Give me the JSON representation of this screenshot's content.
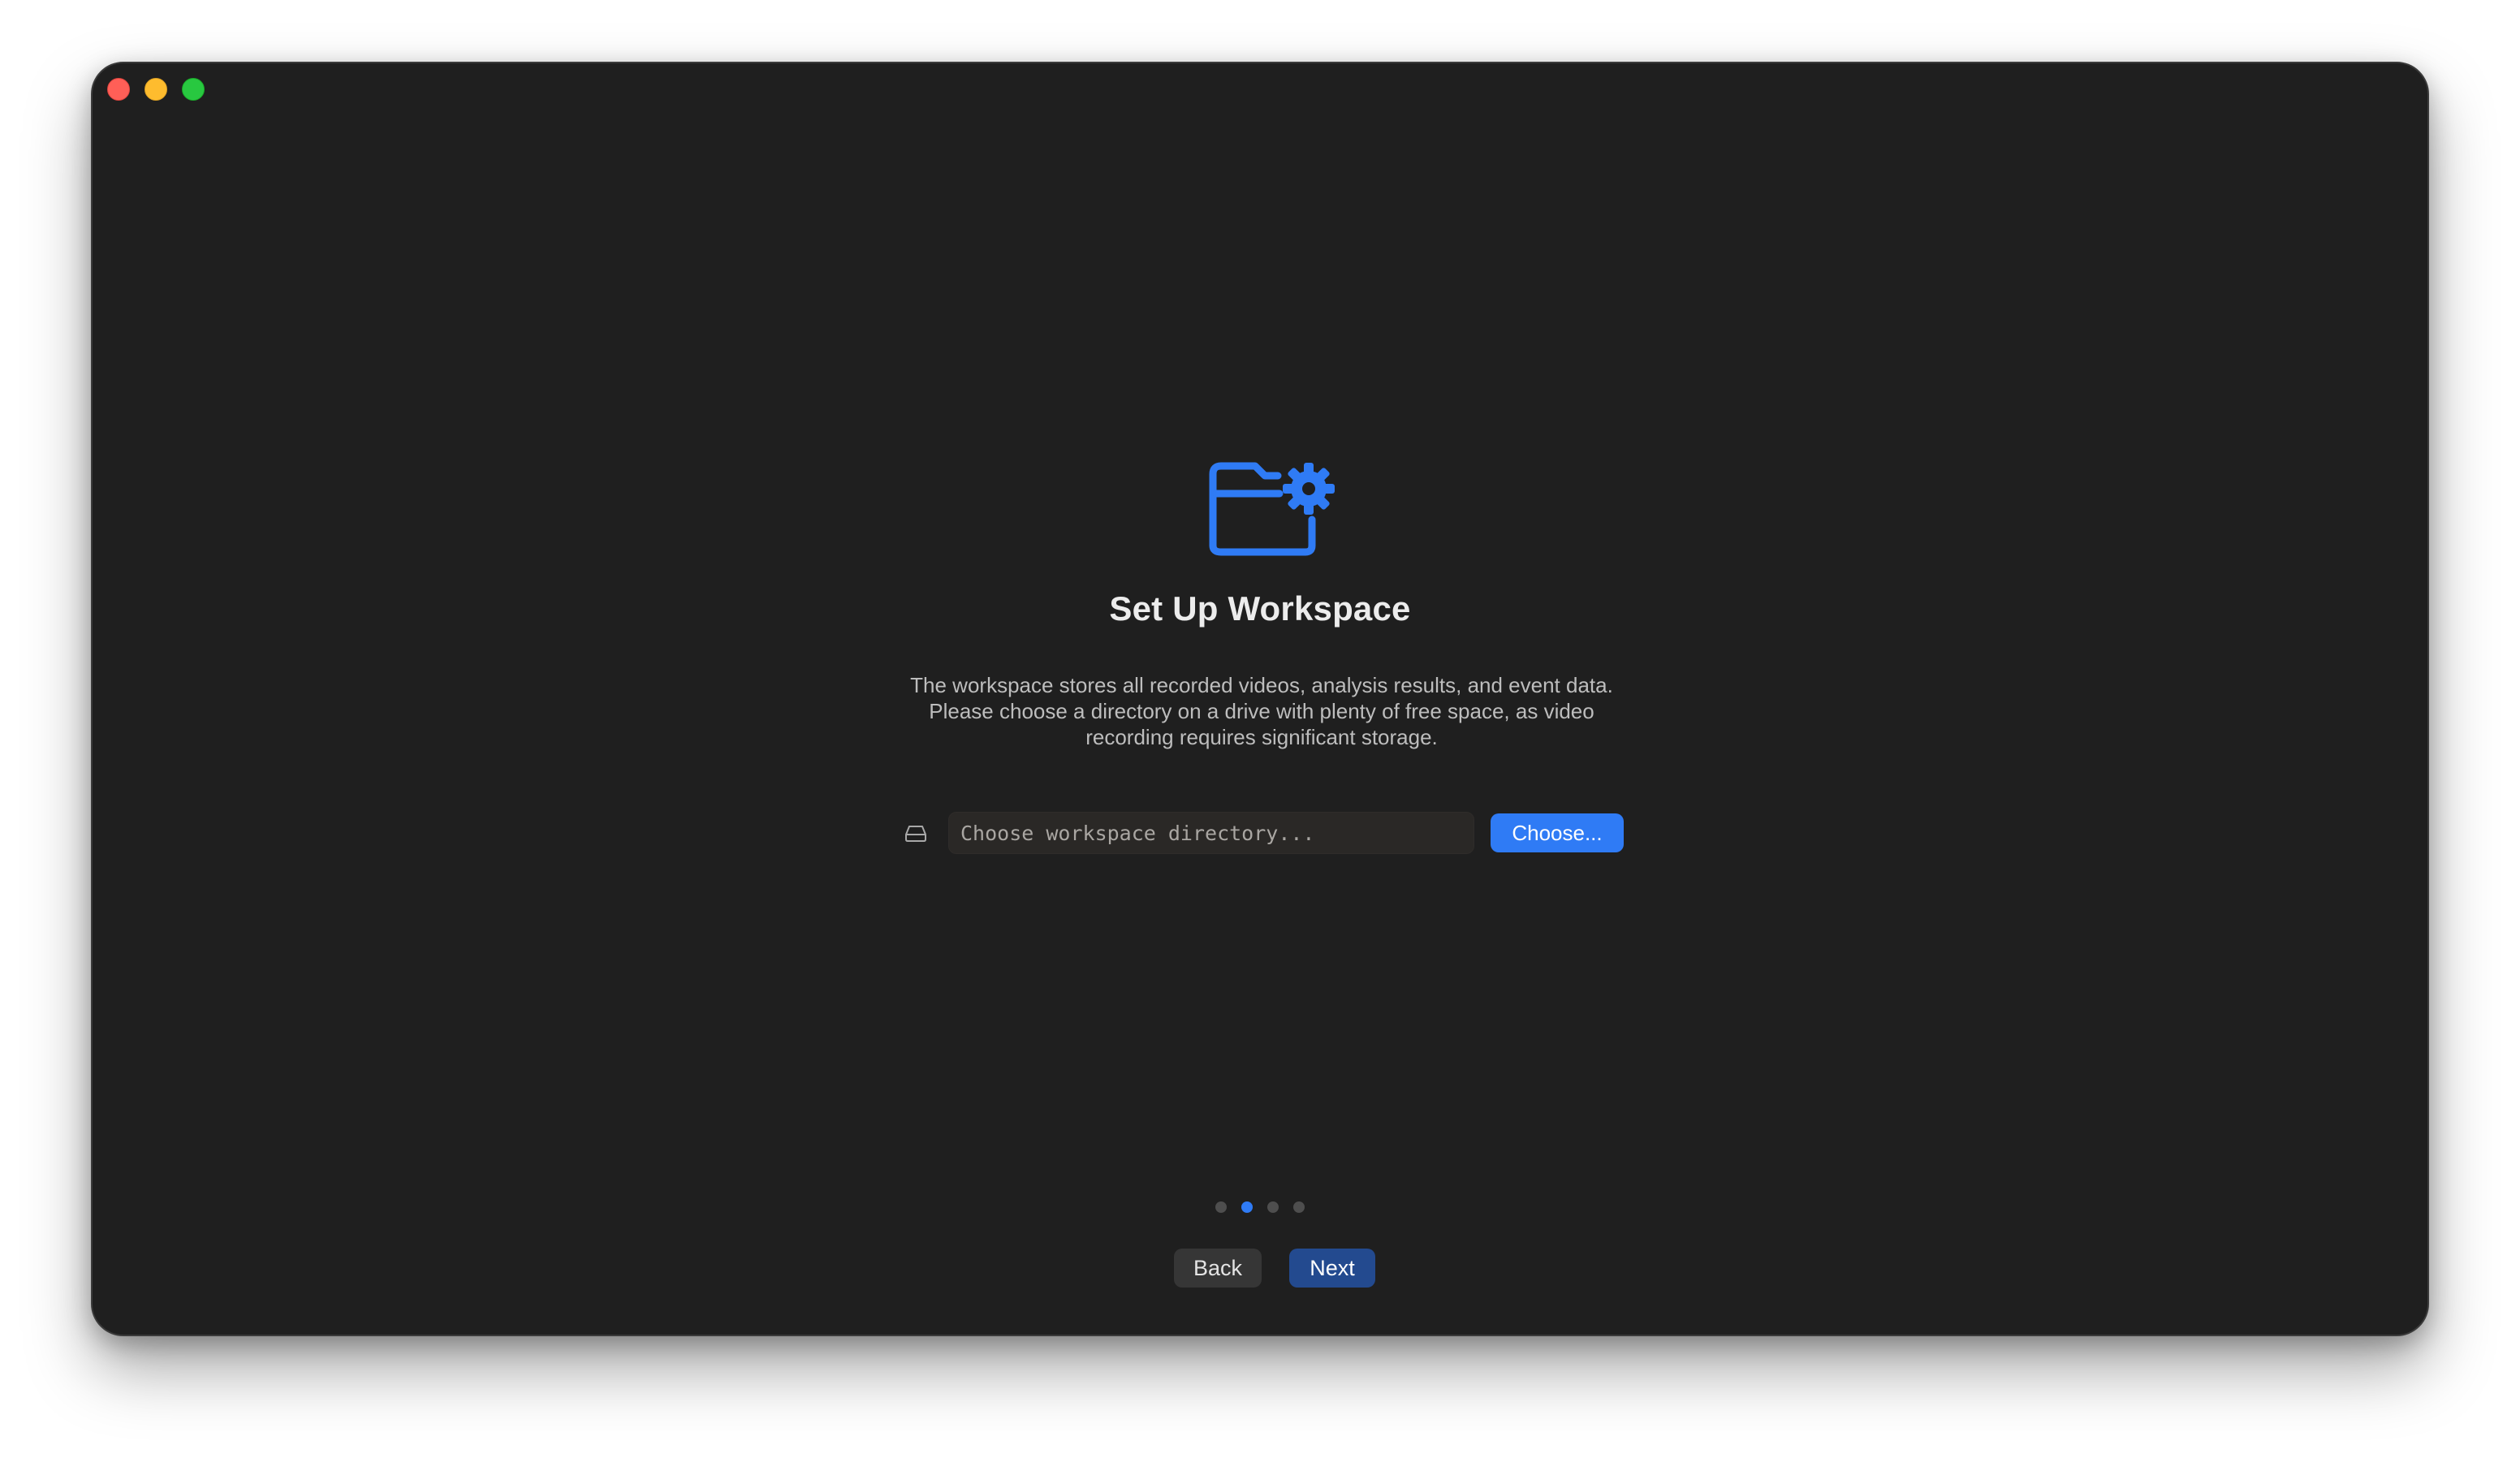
{
  "window": {
    "controls": [
      "close",
      "minimize",
      "zoom"
    ]
  },
  "hero": {
    "icon": "folder-gear-icon",
    "title": "Set Up Workspace",
    "description": [
      "The workspace stores all recorded videos, analysis results, and event data.",
      "Please choose a directory on a drive with plenty of free space, as video recording requires significant storage."
    ]
  },
  "workspace": {
    "drive_icon": "internal-drive-icon",
    "value": "",
    "placeholder": "Choose workspace directory...",
    "choose_label": "Choose..."
  },
  "steps": {
    "total": 4,
    "current": 2
  },
  "nav": {
    "back_label": "Back",
    "next_label": "Next"
  },
  "colors": {
    "accent": "#2f7bf5",
    "next_button": "#234a8f",
    "window_bg": "#1f1f1f"
  }
}
